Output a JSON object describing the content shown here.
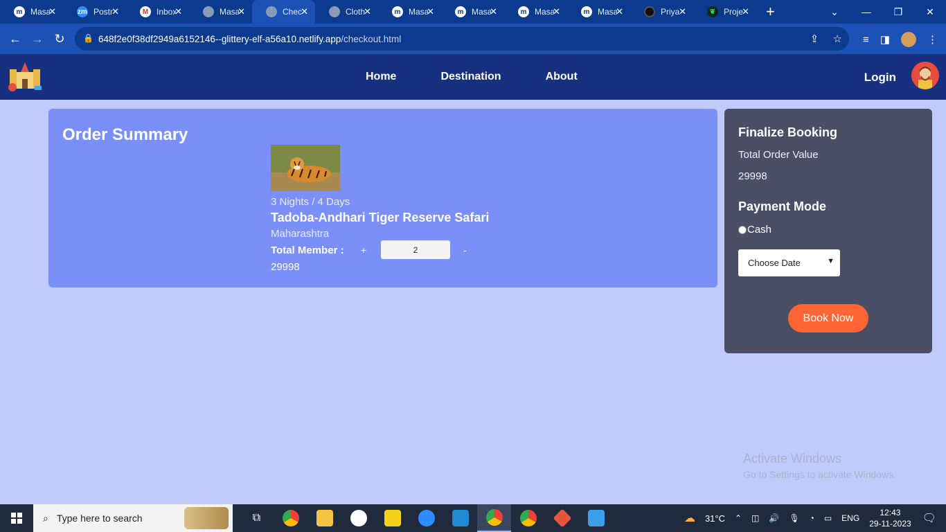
{
  "browser": {
    "tabs": [
      {
        "label": "Masai",
        "icon": "m"
      },
      {
        "label": "Postman",
        "icon": "zm"
      },
      {
        "label": "Inbox",
        "icon": "M"
      },
      {
        "label": "Masai",
        "icon": "globe"
      },
      {
        "label": "Checkout",
        "icon": "globe"
      },
      {
        "label": "Clothes",
        "icon": "globe"
      },
      {
        "label": "Masai",
        "icon": "m"
      },
      {
        "label": "Masai",
        "icon": "m"
      },
      {
        "label": "Masai",
        "icon": "m"
      },
      {
        "label": "Masai",
        "icon": "m"
      },
      {
        "label": "Priya",
        "icon": "github"
      },
      {
        "label": "Project",
        "icon": "leaf"
      }
    ],
    "active_tab": 4,
    "url_host": "648f2e0f38df2949a6152146--glittery-elf-a56a10.netlify.app",
    "url_path": "/checkout.html"
  },
  "site_nav": {
    "links": [
      "Home",
      "Destination",
      "About"
    ],
    "login": "Login"
  },
  "order_summary": {
    "heading": "Order Summary",
    "duration": "3 Nights / 4 Days",
    "title": "Tadoba-Andhari Tiger Reserve Safari",
    "state": "Maharashtra",
    "member_label": "Total Member :",
    "plus": "+",
    "quantity": "2",
    "minus": "-",
    "price": "29998"
  },
  "finalize": {
    "heading": "Finalize Booking",
    "total_label": "Total Order Value",
    "total_value": "29998",
    "payment_heading": "Payment Mode",
    "payment_option": "Cash",
    "date_select": "Choose Date",
    "book_button": "Book Now"
  },
  "watermark": {
    "line1": "Activate Windows",
    "line2": "Go to Settings to activate Windows."
  },
  "taskbar": {
    "search_placeholder": "Type here to search",
    "temperature": "31°C",
    "language": "ENG",
    "time": "12:43",
    "date": "29-11-2023"
  },
  "colors": {
    "page_bg": "#c0cbfb",
    "nav_bg": "#173180",
    "summary_bg": "#7a90f8",
    "final_bg": "#4a4f66",
    "book_button": "#ff6633"
  }
}
